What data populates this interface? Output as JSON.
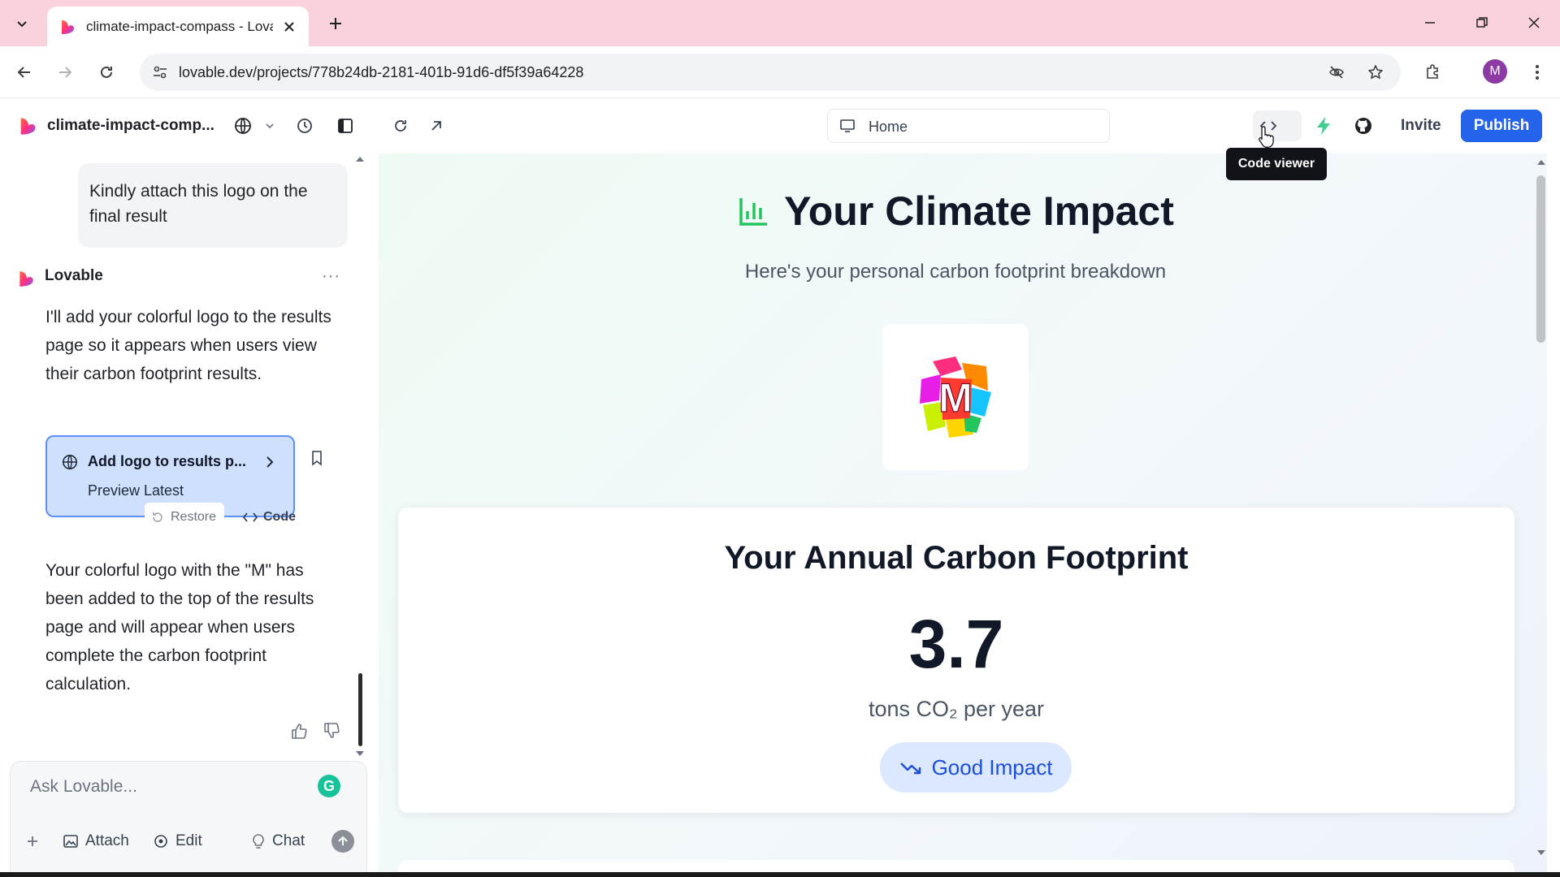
{
  "browser": {
    "tab_title": "climate-impact-compass - Lova",
    "url": "lovable.dev/projects/778b24db-2181-401b-91d6-df5f39a64228",
    "avatar_letter": "M"
  },
  "app": {
    "project_name": "climate-impact-comp...",
    "route": "Home",
    "invite_label": "Invite",
    "publish_label": "Publish",
    "tooltip": "Code viewer",
    "accent": "#2563eb"
  },
  "chat": {
    "user_message": "Kindly attach this logo on the final result",
    "bot_name": "Lovable",
    "bot_more": "···",
    "bot_message_1": "I'll add your colorful logo to the results page so it appears when users view their carbon footprint results.",
    "version_title": "Add logo to results p...",
    "version_subtitle": "Preview Latest",
    "restore_label": "Restore",
    "code_label": "Code",
    "bot_message_2": "Your colorful logo with the \"M\" has been added to the top of the results page and will appear when users complete the carbon footprint calculation.",
    "input_placeholder": "Ask Lovable...",
    "tools": {
      "attach": "Attach",
      "edit": "Edit",
      "chat": "Chat"
    }
  },
  "preview": {
    "title": "Your Climate Impact",
    "subtitle": "Here's your personal carbon footprint breakdown",
    "logo_letter": "M",
    "card_title": "Your Annual Carbon Footprint",
    "value": "3.7",
    "unit": "tons CO₂ per year",
    "impact_label": "Good Impact",
    "impact_color": "#1d4ed8"
  }
}
